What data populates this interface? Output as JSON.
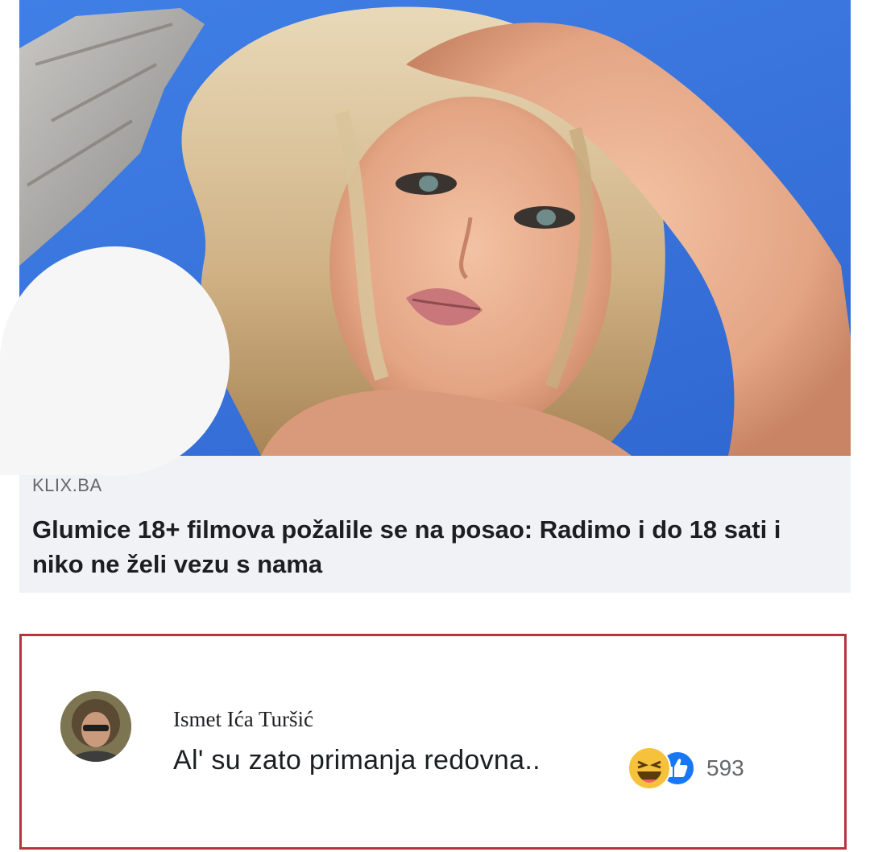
{
  "link_preview": {
    "source": "KLIX.BA",
    "headline": "Glumice 18+ filmova požalile se na posao: Radimo i do 18 sati i niko ne želi vezu s nama"
  },
  "comment": {
    "author": "Ismet Ića Turšić",
    "text": "Al' su zato primanja redovna..",
    "reactions": [
      "haha-icon",
      "like-icon"
    ],
    "reaction_count": "593"
  },
  "colors": {
    "highlight_border": "#b4343d",
    "sky": "#3a76de",
    "like_blue": "#1877f2",
    "haha_yellow": "#f7c23b"
  }
}
